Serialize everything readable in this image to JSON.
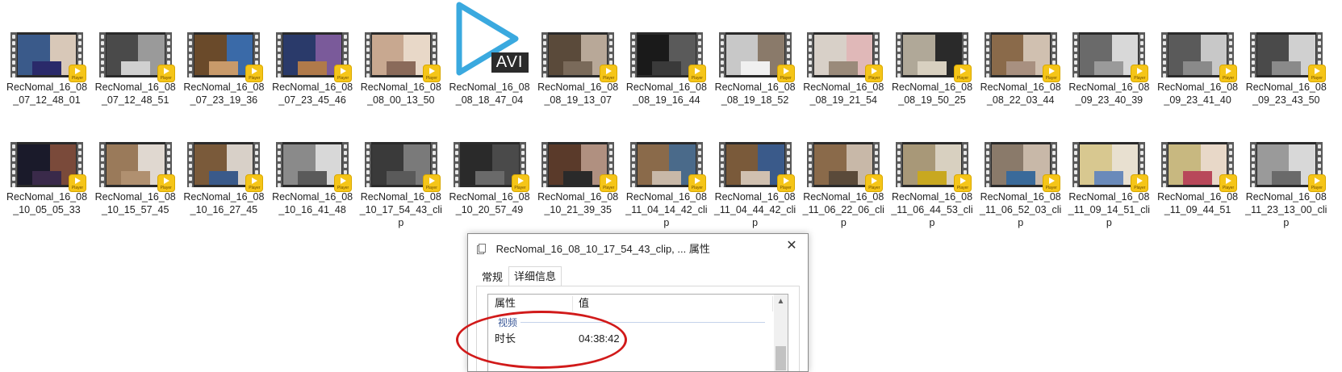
{
  "files_row1": [
    {
      "name": "RecNomal_16_08_07_12_48_01",
      "palette": [
        "#3a5a8a",
        "#d8c8b8",
        "#2a2a6a"
      ]
    },
    {
      "name": "RecNomal_16_08_07_12_48_51",
      "palette": [
        "#4a4a4a",
        "#9a9a9a",
        "#d0d0d0"
      ]
    },
    {
      "name": "RecNomal_16_08_07_23_19_36",
      "palette": [
        "#6a4a2a",
        "#3a6aa8",
        "#c89a6a"
      ]
    },
    {
      "name": "RecNomal_16_08_07_23_45_46",
      "palette": [
        "#2a3a6a",
        "#7a5a9a",
        "#b07a4a"
      ]
    },
    {
      "name": "RecNomal_16_08_08_00_13_50",
      "palette": [
        "#c8a890",
        "#e8d8c8",
        "#8a6a5a"
      ]
    },
    {
      "name": "RecNomal_16_08_08_18_47_04",
      "avi": true
    },
    {
      "name": "RecNomal_16_08_08_19_13_07",
      "palette": [
        "#5a4a3a",
        "#b8a898",
        "#7a6a5a"
      ]
    },
    {
      "name": "RecNomal_16_08_08_19_16_44",
      "palette": [
        "#1a1a1a",
        "#5a5a5a",
        "#3a3a3a"
      ]
    },
    {
      "name": "RecNomal_16_08_08_19_18_52",
      "palette": [
        "#c8c8c8",
        "#8a7a6a",
        "#f0f0f0"
      ]
    },
    {
      "name": "RecNomal_16_08_08_19_21_54",
      "palette": [
        "#d8d0c8",
        "#e0b8b8",
        "#9a8a7a"
      ]
    },
    {
      "name": "RecNomal_16_08_08_19_50_25",
      "palette": [
        "#b0a898",
        "#2a2a2a",
        "#d8d0c0"
      ]
    },
    {
      "name": "RecNomal_16_08_08_22_03_44",
      "palette": [
        "#8a6a4a",
        "#d0c0b0",
        "#a89080"
      ]
    },
    {
      "name": "RecNomal_16_08_09_23_40_39",
      "palette": [
        "#6a6a6a",
        "#d8d8d8",
        "#9a9a9a"
      ]
    },
    {
      "name": "RecNomal_16_08_09_23_41_40",
      "palette": [
        "#5a5a5a",
        "#c8c8c8",
        "#8a8a8a"
      ]
    },
    {
      "name": "RecNomal_16_08_09_23_43_50",
      "palette": [
        "#4a4a4a",
        "#d0d0d0",
        "#8a8a8a"
      ]
    }
  ],
  "files_row2": [
    {
      "name": "RecNomal_16_08_10_05_05_33",
      "palette": [
        "#1a1a2a",
        "#7a4a3a",
        "#3a2a4a"
      ]
    },
    {
      "name": "RecNomal_16_08_10_15_57_45",
      "palette": [
        "#9a7a5a",
        "#e0d8d0",
        "#b09070"
      ]
    },
    {
      "name": "RecNomal_16_08_10_16_27_45",
      "palette": [
        "#7a5a3a",
        "#d8d0c8",
        "#3a5a8a"
      ]
    },
    {
      "name": "RecNomal_16_08_10_16_41_48",
      "palette": [
        "#8a8a8a",
        "#d8d8d8",
        "#5a5a5a"
      ]
    },
    {
      "name": "RecNomal_16_08_10_17_54_43_clip",
      "palette": [
        "#3a3a3a",
        "#7a7a7a",
        "#5a5a5a"
      ]
    },
    {
      "name": "RecNomal_16_08_10_20_57_49",
      "palette": [
        "#2a2a2a",
        "#4a4a4a",
        "#6a6a6a"
      ]
    },
    {
      "name": "RecNomal_16_08_10_21_39_35",
      "palette": [
        "#5a3a2a",
        "#b09080",
        "#2a2a2a"
      ]
    },
    {
      "name": "RecNomal_16_08_11_04_14_42_clip",
      "palette": [
        "#8a6a4a",
        "#4a6a8a",
        "#c8b8a8"
      ]
    },
    {
      "name": "RecNomal_16_08_11_04_44_42_clip",
      "palette": [
        "#7a5a3a",
        "#3a5a8a",
        "#d0c0b0"
      ]
    },
    {
      "name": "RecNomal_16_08_11_06_22_06_clip",
      "palette": [
        "#8a6a4a",
        "#c8b8a8",
        "#5a4a3a"
      ]
    },
    {
      "name": "RecNomal_16_08_11_06_44_53_clip",
      "palette": [
        "#a89878",
        "#d8d0c0",
        "#c8a820"
      ]
    },
    {
      "name": "RecNomal_16_08_11_06_52_03_clip",
      "palette": [
        "#8a7a6a",
        "#c8b8a8",
        "#3a6a9a"
      ]
    },
    {
      "name": "RecNomal_16_08_11_09_14_51_clip",
      "palette": [
        "#d8c890",
        "#e8e0d0",
        "#6a8aba"
      ]
    },
    {
      "name": "RecNomal_16_08_11_09_44_51",
      "palette": [
        "#c8b880",
        "#e8d8c8",
        "#b8485a"
      ]
    },
    {
      "name": "RecNomal_16_08_11_23_13_00_clip",
      "palette": [
        "#9a9a9a",
        "#d8d8d8",
        "#6a6a6a"
      ]
    }
  ],
  "badge_text": "Player",
  "avi_text": "AVI",
  "dialog": {
    "title": "RecNomal_16_08_10_17_54_43_clip, ... 属性",
    "close": "✕",
    "tabs": [
      {
        "label": "常规",
        "active": false
      },
      {
        "label": "详细信息",
        "active": true
      }
    ],
    "columns": {
      "property": "属性",
      "value": "值"
    },
    "group": "视频",
    "rows": [
      {
        "key": "时长",
        "value": "04:38:42"
      }
    ]
  },
  "colors": {
    "badge": "#f5c518",
    "avi_accent": "#3aa9df",
    "highlight_ring": "#d11a1a"
  }
}
